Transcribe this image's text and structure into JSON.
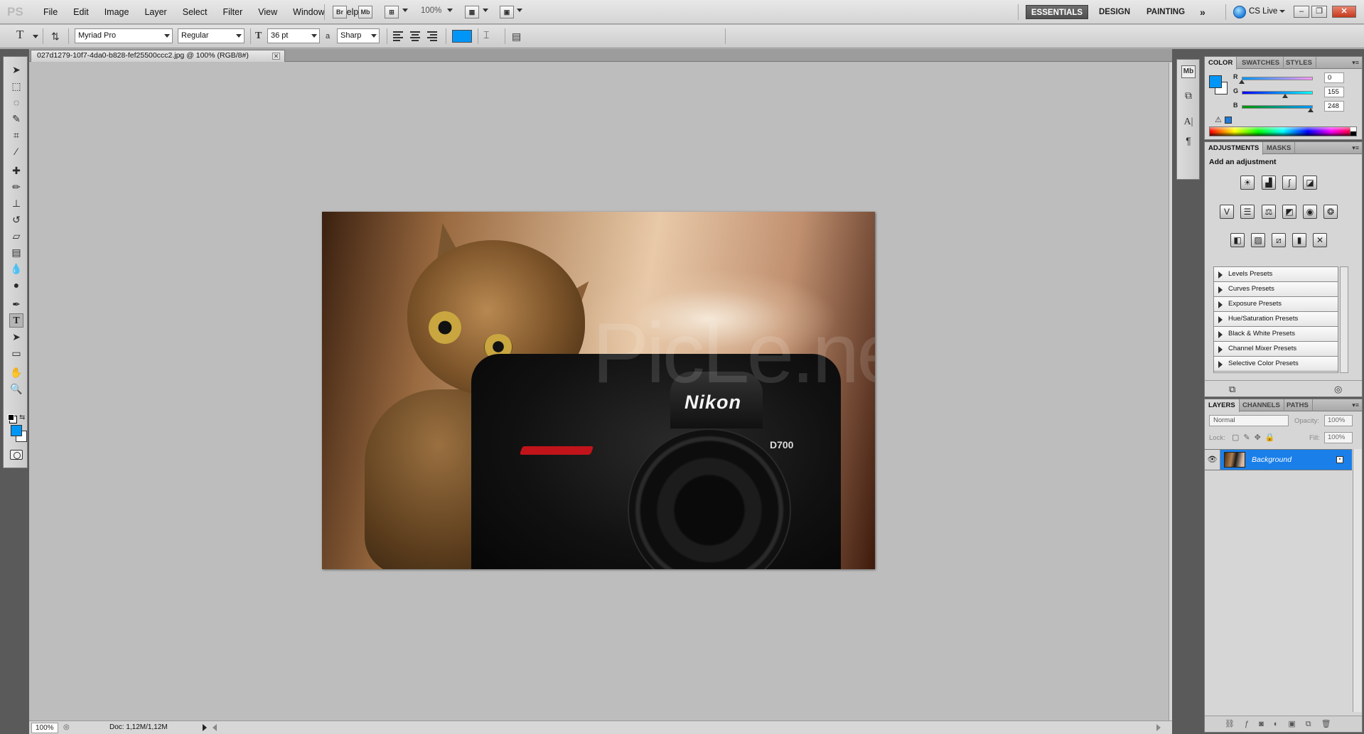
{
  "app": {
    "logo": "PS"
  },
  "menubar": {
    "menus": [
      "File",
      "Edit",
      "Image",
      "Layer",
      "Select",
      "Filter",
      "View",
      "Window",
      "Help"
    ],
    "bridge_label": "Br",
    "minibridge_label": "Mb",
    "zoom": "100%",
    "workspaces": {
      "essentials": "ESSENTIALS",
      "design": "DESIGN",
      "painting": "PAINTING",
      "more": "»"
    },
    "cslive": "CS Live",
    "window_controls": {
      "minimize": "–",
      "restore": "❐",
      "close": "✕"
    }
  },
  "options": {
    "tool_glyph": "T",
    "font_family": "Myriad Pro",
    "font_style": "Regular",
    "font_size": "36 pt",
    "antialias_label": "a",
    "antialias": "Sharp",
    "text_color": "#0096f8"
  },
  "document": {
    "tab_title": "027d1279-10f7-4da0-b828-fef25500ccc2.jpg @ 100% (RGB/8#)",
    "close_glyph": "✕",
    "canvas": {
      "brand_text": "Nikon",
      "model_text": "D700",
      "watermark": "PicLe.net"
    },
    "status": {
      "zoom": "100%",
      "doc_size": "Doc: 1,12M/1,12M"
    }
  },
  "tools": [
    "move",
    "marquee",
    "lasso",
    "quick-select",
    "crop",
    "eyedropper",
    "healing",
    "brush",
    "clone-stamp",
    "history-brush",
    "eraser",
    "gradient",
    "blur",
    "dodge",
    "pen",
    "type",
    "path-select",
    "shape",
    "hand",
    "zoom"
  ],
  "colors": {
    "foreground": "#0096f8",
    "background": "#ffffff",
    "accent": "#1a7fe8"
  },
  "color_panel": {
    "tabs": [
      "COLOR",
      "SWATCHES",
      "STYLES"
    ],
    "r_label": "R",
    "g_label": "G",
    "b_label": "B",
    "r": "0",
    "g": "155",
    "b": "248",
    "r_frac": 0.0,
    "g_frac": 0.61,
    "b_frac": 0.97
  },
  "adjustments_panel": {
    "tabs": [
      "ADJUSTMENTS",
      "MASKS"
    ],
    "title": "Add an adjustment",
    "presets": [
      "Levels Presets",
      "Curves Presets",
      "Exposure Presets",
      "Hue/Saturation Presets",
      "Black & White Presets",
      "Channel Mixer Presets",
      "Selective Color Presets"
    ]
  },
  "layers_panel": {
    "tabs": [
      "LAYERS",
      "CHANNELS",
      "PATHS"
    ],
    "blend_mode": "Normal",
    "opacity_label": "Opacity:",
    "opacity": "100%",
    "lock_label": "Lock:",
    "fill_label": "Fill:",
    "fill": "100%",
    "layers": [
      {
        "name": "Background",
        "visible": true,
        "locked": true
      }
    ]
  }
}
